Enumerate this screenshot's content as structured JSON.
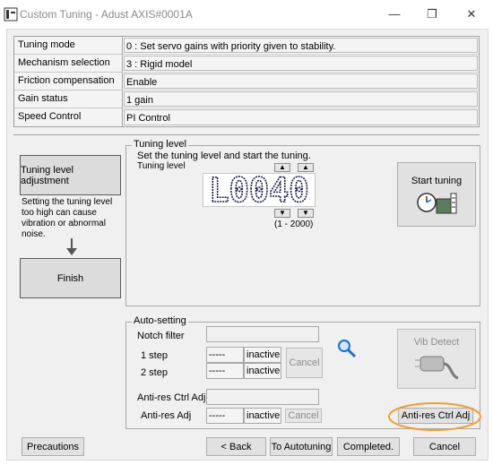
{
  "window": {
    "title": "Custom Tuning - Adust AXIS#0001A",
    "minimize_icon": "minimize-icon",
    "restore_icon": "restore-icon",
    "close_icon": "close-icon"
  },
  "info": {
    "rows": [
      {
        "label": "Tuning mode",
        "value": "0 : Set servo gains with priority given to stability."
      },
      {
        "label": "Mechanism selection",
        "value": "3 : Rigid model"
      },
      {
        "label": "Friction compensation",
        "value": "Enable"
      },
      {
        "label": "Gain status",
        "value": "1 gain"
      },
      {
        "label": "Speed Control",
        "value": "PI Control"
      }
    ]
  },
  "steps": {
    "step1_label": "Tuning level adjustment",
    "step1_note": "Setting the tuning level too high can cause vibration or abnormal noise.",
    "step2_label": "Finish"
  },
  "tuning_level": {
    "group_title": "Tuning level",
    "instruction": "Set the tuning level and start the tuning.",
    "level_label": "Tuning level",
    "display_value": "L0040",
    "range": "(1 - 2000)",
    "start_button": "Start tuning"
  },
  "auto_setting": {
    "group_title": "Auto-setting",
    "notch_label": "Notch filter",
    "step1_label": "1 step",
    "step1_value": "-----",
    "step1_status": "inactive",
    "step2_label": "2 step",
    "step2_value": "-----",
    "step2_status": "inactive",
    "cancel_label": "Cancel",
    "antires_ctrl_label": "Anti-res Ctrl Adj",
    "antires_adj_label": "Anti-res Adj",
    "antires_value": "-----",
    "antires_status": "inactive",
    "antires_cancel": "Cancel",
    "vib_detect": "Vib Detect",
    "antires_button": "Anti-res Ctrl Adj",
    "highlight_color": "#f0a030"
  },
  "footer": {
    "precautions": "Precautions",
    "back": "< Back",
    "to_autotuning": "To Autotuning",
    "completed": "Completed.",
    "cancel": "Cancel"
  }
}
